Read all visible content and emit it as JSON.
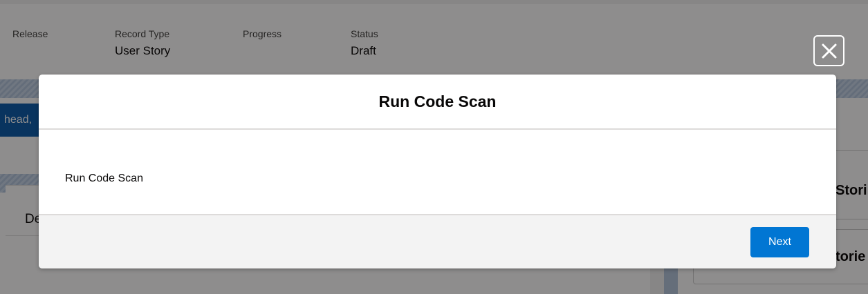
{
  "record": {
    "fields": [
      {
        "label": "Release",
        "value": ""
      },
      {
        "label": "Record Type",
        "value": "User Story"
      },
      {
        "label": "Progress",
        "value": ""
      },
      {
        "label": "Status",
        "value": "Draft"
      }
    ],
    "pill_text": "head,",
    "left_card_title": "De",
    "right_text_1": "Stori",
    "right_text_2": "torie"
  },
  "modal": {
    "title": "Run Code Scan",
    "body_text": "Run Code Scan",
    "next_label": "Next",
    "close_icon": "close-icon"
  },
  "colors": {
    "brand_button": "#0176d3",
    "overlay": "rgba(8,7,7,0.46)"
  }
}
